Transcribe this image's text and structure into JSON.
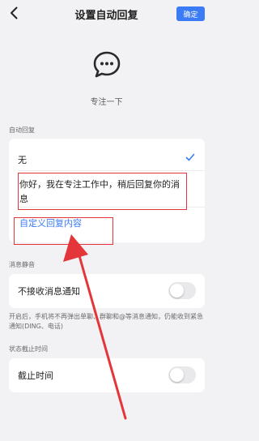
{
  "nav": {
    "title": "设置自动回复",
    "confirm": "确定"
  },
  "status": {
    "text": "专注一下"
  },
  "auto_reply": {
    "section_label": "自动回复",
    "none_option": "无",
    "preset_message": "你好，我在专注工作中，稍后回复你的消息",
    "custom_link": "自定义回复内容"
  },
  "mute": {
    "section_label": "消息静音",
    "toggle_label": "不接收消息通知",
    "description": "开启后，手机将不再弹出单聊、群聊和@等消息通知，仍能收到紧急通知(DING、电话)",
    "enabled": false
  },
  "status_end": {
    "section_label": "状态截止时间",
    "toggle_label": "截止时间",
    "enabled": false
  },
  "colors": {
    "accent": "#3b7cf6",
    "highlight": "#e3353a"
  }
}
